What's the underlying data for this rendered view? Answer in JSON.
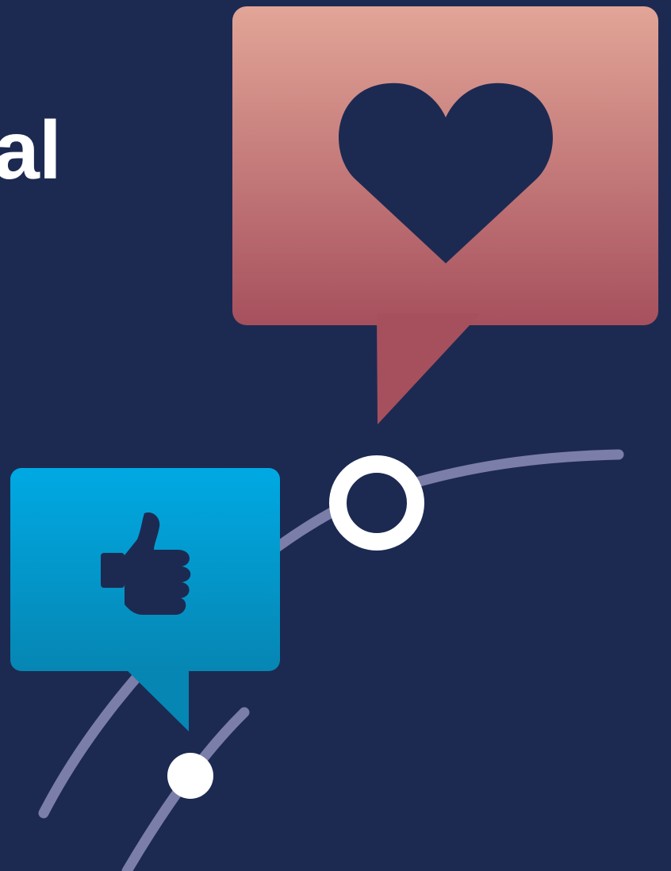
{
  "headline": {
    "text": "al"
  },
  "colors": {
    "background": "#1c2a52",
    "headline_text": "#ffffff",
    "heart_bubble_top": "#e2a597",
    "heart_bubble_bottom": "#a6505d",
    "heart_fill": "#1c2a52",
    "like_bubble_top": "#00a9e3",
    "like_bubble_bottom": "#0686b3",
    "thumb_fill": "#1c2a52",
    "path_line": "#7b7ea8",
    "marker": "#ffffff"
  },
  "icons": {
    "heart": "heart-icon",
    "thumbs_up": "thumbs-up-icon"
  }
}
